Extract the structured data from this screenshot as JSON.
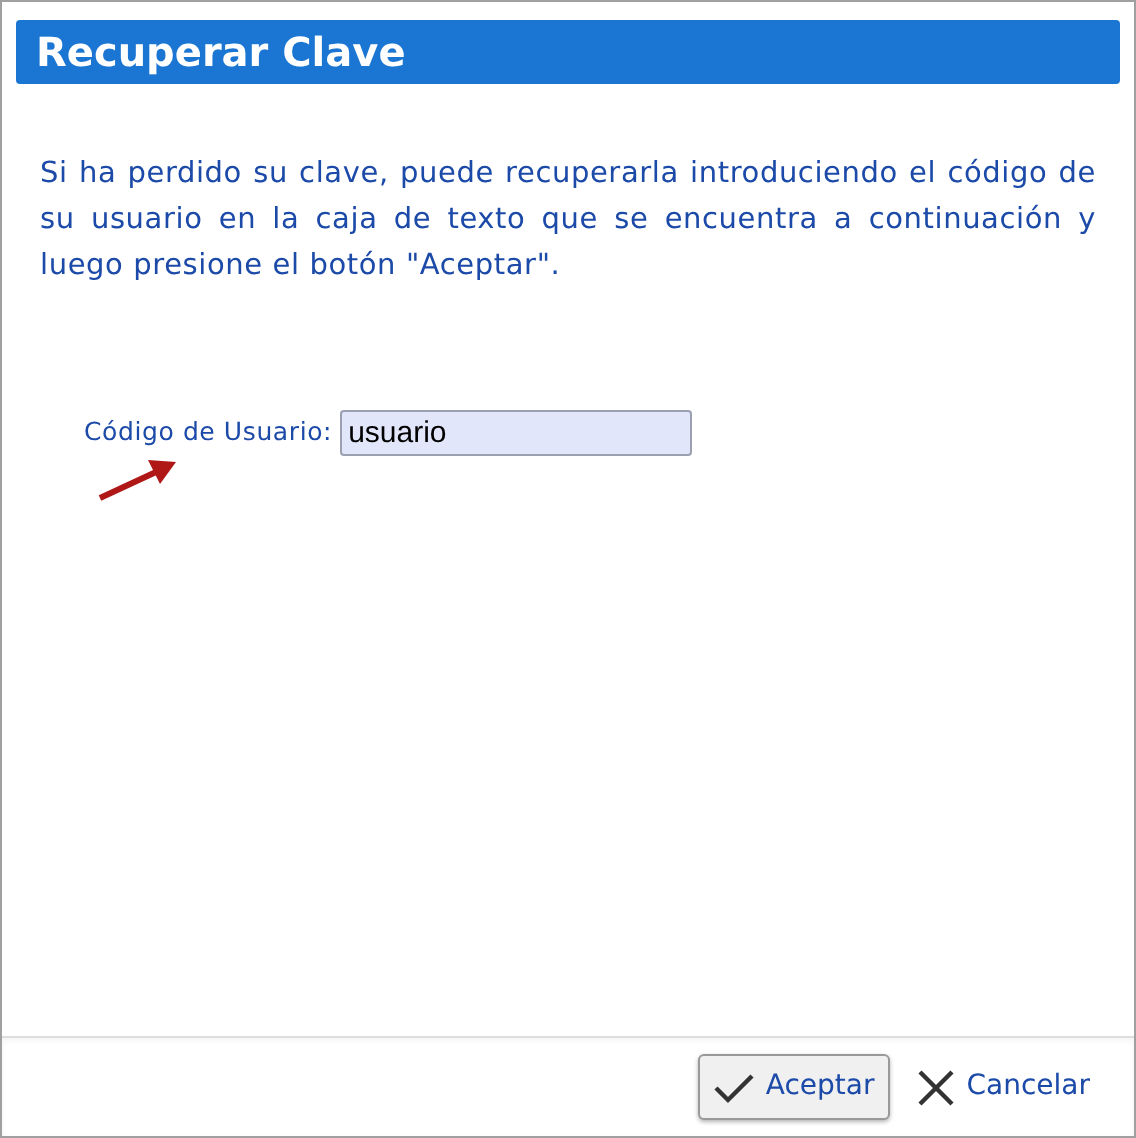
{
  "dialog": {
    "title": "Recuperar Clave",
    "instructions": "Si ha perdido su clave, puede recuperarla introduciendo el código de su usuario en la caja de texto que se encuentra a continuación y luego presione el botón \"Aceptar\".",
    "field": {
      "label": "Código de Usuario:",
      "value": "usuario"
    },
    "buttons": [
      {
        "label": "Aceptar",
        "kind": "accept"
      },
      {
        "label": "Cancelar",
        "kind": "cancel"
      }
    ]
  }
}
